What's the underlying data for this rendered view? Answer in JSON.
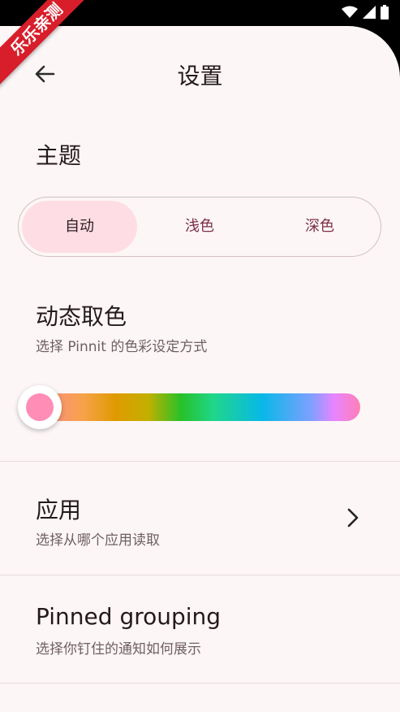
{
  "ribbon": {
    "text": "乐乐亲测"
  },
  "topbar": {
    "title": "设置"
  },
  "theme": {
    "title": "主题",
    "options": [
      "自动",
      "浅色",
      "深色"
    ],
    "selected_index": 0
  },
  "dynamic_color": {
    "title": "动态取色",
    "subtitle": "选择 Pinnit 的色彩设定方式",
    "slider_value": 0.0
  },
  "apps": {
    "title": "应用",
    "subtitle": "选择从哪个应用读取"
  },
  "pinned_grouping": {
    "title": "Pinned grouping",
    "subtitle": "选择你钉住的通知如何展示"
  },
  "colors": {
    "accent": "#fedde5",
    "thumb": "#ff8db5",
    "background": "#fdf6f6"
  }
}
